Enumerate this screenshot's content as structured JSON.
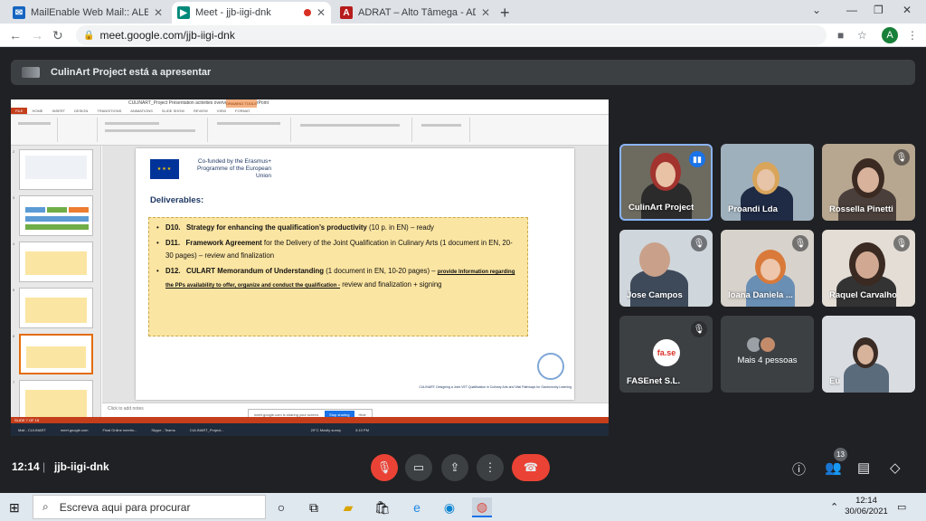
{
  "browser": {
    "tabs": [
      {
        "title": "MailEnable Web Mail:: ALEXANDI",
        "icon": "mail-icon",
        "active": false
      },
      {
        "title": "Meet - jjb-iigi-dnk",
        "icon": "meet-icon",
        "active": true,
        "recording": true
      },
      {
        "title": "ADRAT – Alto Tâmega - ADRAT -",
        "icon": "adrat-icon",
        "active": false
      }
    ],
    "url": "meet.google.com/jjb-iigi-dnk",
    "profile_initial": "A"
  },
  "meet": {
    "presenting_banner": "CulinArt Project está a apresentar",
    "time": "12:14",
    "separator": "|",
    "meeting_code": "jjb-iigi-dnk",
    "participants_count": "13",
    "participants": [
      {
        "name": "CulinArt Project",
        "speaking": true
      },
      {
        "name": "Proandi Lda",
        "muted": false
      },
      {
        "name": "Rossella Pinetti",
        "muted": true
      },
      {
        "name": "Jose Campos",
        "muted": true
      },
      {
        "name": "Ioana Daniela ...",
        "muted": true
      },
      {
        "name": "Raquel Carvalho",
        "muted": true
      },
      {
        "name": "FASEnet S.L.",
        "muted": true,
        "logo_text": "fa.se"
      },
      {
        "name": "Mais 4 pessoas"
      },
      {
        "name": "Eu"
      }
    ]
  },
  "presentation": {
    "window_title": "CULINART_Project Presentation activities overview final - PowerPoint",
    "drawing_tools_tab": "DRAWING TOOLS",
    "ribbon_tabs": [
      "FILE",
      "HOME",
      "INSERT",
      "DESIGN",
      "TRANSITIONS",
      "ANIMATIONS",
      "SLIDE SHOW",
      "REVIEW",
      "VIEW",
      "FORMAT"
    ],
    "slide_numbers": [
      "2",
      "3",
      "4",
      "5",
      "6",
      "7"
    ],
    "eu_text": "Co-funded by the Erasmus+ Programme of the European Union",
    "deliverables_title": "Deliverables:",
    "items": [
      {
        "code": "D10.",
        "title": "Strategy for enhancing the qualification’s productivity",
        "rest": " (10 p. in EN) – ready"
      },
      {
        "code": "D11.",
        "title": "Framework Agreement",
        "rest": " for the Delivery of the Joint Qualification in Culinary Arts (1 document in EN, 20-30 pages) – review and finalization"
      },
      {
        "code": "D12.",
        "title": "CULART Memorandum of Understanding",
        "rest": " (1 document in EN, 10-20 pages) – ",
        "underlined": "provide Information regarding the PPs availability to offer, organize and conduct the qualification -",
        "tail": " review and finalization + signing"
      }
    ],
    "footer_text": "CULINART: Designing a Joint VET Qualification in Culinary Arts and Vital Pathways for Gastronomy Learning",
    "notes_placeholder": "Click to add notes",
    "share_text": "meet.google.com is sharing your screen.",
    "stop_sharing": "Stop sharing",
    "hide": "Hide",
    "status_text": "SLIDE 7 OF 15",
    "inner_taskbar_items": [
      "Mail - CULINART",
      "meet.google.com",
      "Final Online meetin...",
      "Skype - Teams",
      "CULINART_Project..."
    ],
    "weather": "29°C Mostly sunny",
    "inner_clock": "3:10 PM"
  },
  "windows": {
    "search_placeholder": "Escreva aqui para procurar",
    "clock_time": "12:14",
    "clock_date": "30/06/2021"
  },
  "colors": {
    "meet_red": "#ea4335",
    "accent_blue": "#1a73e8",
    "slide_yellow": "#fbe5a2",
    "powerpoint_orange": "#c43e1c"
  }
}
